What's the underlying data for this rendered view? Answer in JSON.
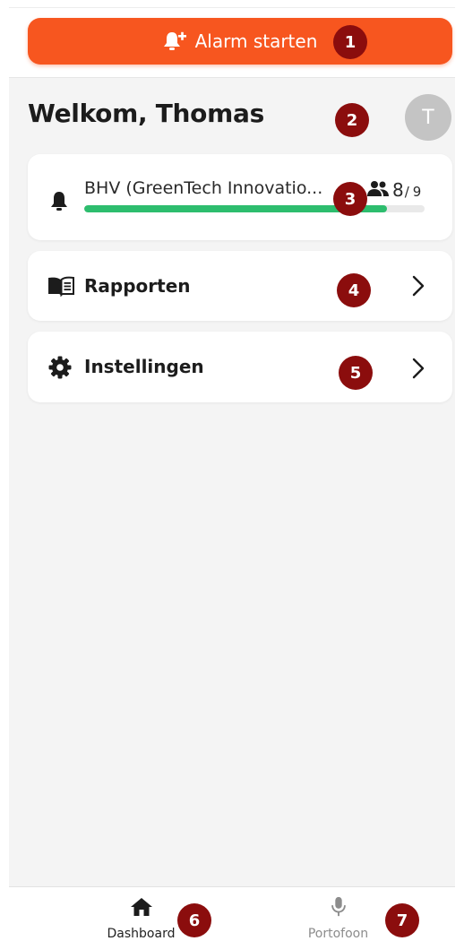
{
  "alarm": {
    "label": "Alarm starten",
    "icon": "bell-plus-icon",
    "color": "#f7561f"
  },
  "welcome": {
    "title": "Welkom, Thomas",
    "avatar_initial": "T"
  },
  "team_card": {
    "icon": "bell-icon",
    "name": "BHV (GreenTech Innovatio...",
    "members_icon": "people-icon",
    "present": "8",
    "separator": "/",
    "total": "9",
    "progress": 0.89,
    "progress_color": "#2dbd6e"
  },
  "menu": {
    "reports_label": "Rapporten",
    "reports_icon": "book-icon",
    "settings_label": "Instellingen",
    "settings_icon": "gear-icon"
  },
  "bottom_nav": {
    "dashboard_label": "Dashboard",
    "dashboard_icon": "home-icon",
    "radio_label": "Portofoon",
    "radio_icon": "microphone-icon"
  },
  "markers": [
    "1",
    "2",
    "3",
    "4",
    "5",
    "6",
    "7"
  ]
}
